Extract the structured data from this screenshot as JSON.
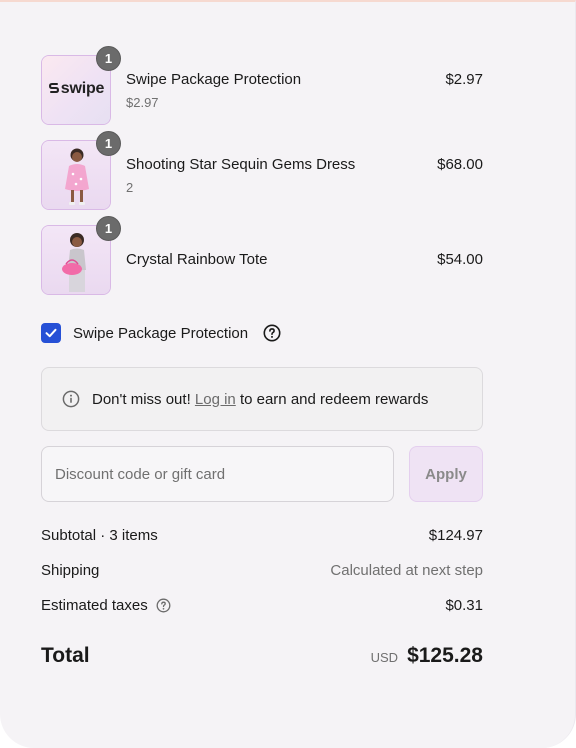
{
  "line_items": [
    {
      "name": "Swipe Package Protection",
      "subtitle": "$2.97",
      "price": "$2.97",
      "quantity": "1",
      "thumb_logo": "swipe"
    },
    {
      "name": "Shooting Star Sequin Gems Dress",
      "subtitle": "2",
      "price": "$68.00",
      "quantity": "1"
    },
    {
      "name": "Crystal Rainbow Tote",
      "subtitle": "",
      "price": "$54.00",
      "quantity": "1"
    }
  ],
  "protection": {
    "label": "Swipe Package Protection",
    "checked": true
  },
  "notice": {
    "prefix": "Don't miss out! ",
    "link": "Log in",
    "suffix": " to earn and redeem rewards"
  },
  "discount": {
    "placeholder": "Discount code or gift card",
    "value": "",
    "apply_label": "Apply"
  },
  "summary": {
    "subtotal_label": "Subtotal · 3 items",
    "subtotal_value": "$124.97",
    "shipping_label": "Shipping",
    "shipping_value": "Calculated at next step",
    "taxes_label": "Estimated taxes",
    "taxes_value": "$0.31",
    "total_label": "Total",
    "currency": "USD",
    "total_value": "$125.28"
  },
  "icons": {
    "protection_help": "question-circle-icon",
    "notice": "info-circle-icon",
    "taxes_help": "question-circle-icon",
    "checkbox": "checkmark-icon"
  },
  "colors": {
    "accent": "#2650d6",
    "badge": "#6b6b6b",
    "thumb_border": "#d9b9e6",
    "panel": "#f5f3f6"
  }
}
